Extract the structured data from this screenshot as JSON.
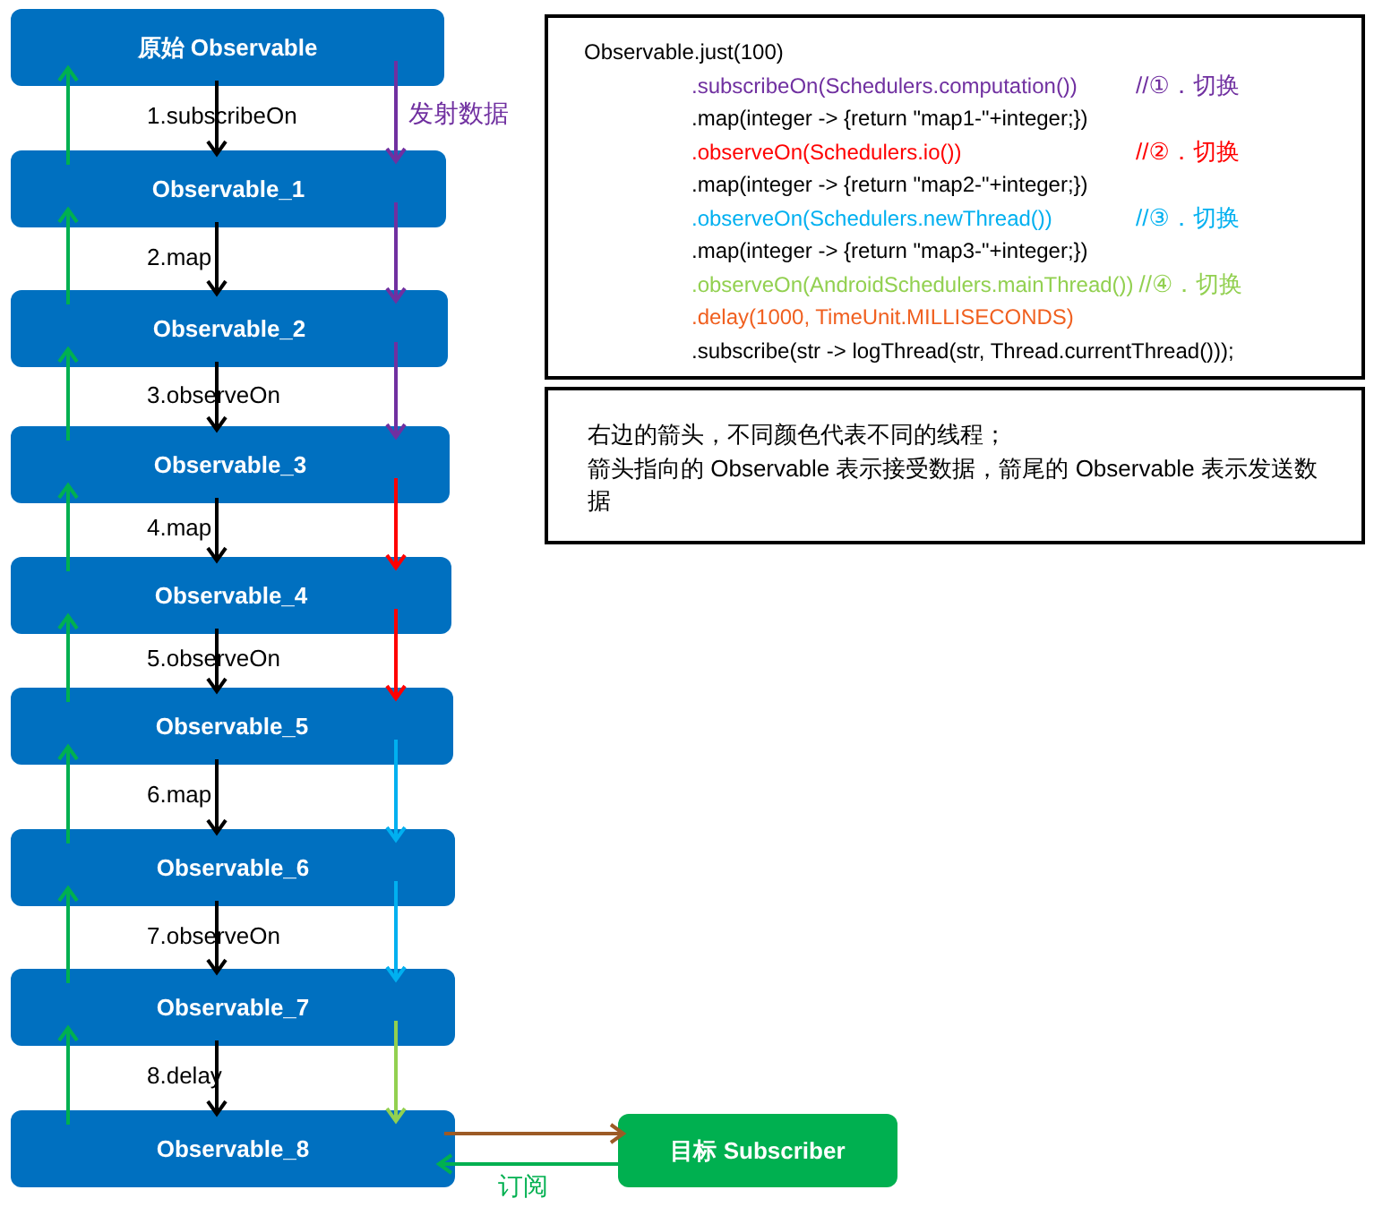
{
  "nodes": [
    {
      "label": "原始 Observable"
    },
    {
      "label": "Observable_1"
    },
    {
      "label": "Observable_2"
    },
    {
      "label": "Observable_3"
    },
    {
      "label": "Observable_4"
    },
    {
      "label": "Observable_5"
    },
    {
      "label": "Observable_6"
    },
    {
      "label": "Observable_7"
    },
    {
      "label": "Observable_8"
    }
  ],
  "steps": [
    {
      "label": "1.subscribeOn",
      "color": "#7030a0"
    },
    {
      "label": "2.map",
      "color": "#7030a0"
    },
    {
      "label": "3.observeOn",
      "color": "#7030a0"
    },
    {
      "label": "4.map",
      "color": "#ff0000"
    },
    {
      "label": "5.observeOn",
      "color": "#ff0000"
    },
    {
      "label": "6.map",
      "color": "#00b0f0"
    },
    {
      "label": "7.observeOn",
      "color": "#00b0f0"
    },
    {
      "label": "8.delay",
      "color": "#92d050"
    }
  ],
  "emit_label": "发射数据",
  "subscriber": {
    "label": "目标 Subscriber"
  },
  "subscribe_label": "订阅",
  "code": {
    "lines": [
      {
        "text": "Observable.just(100)",
        "color": "#000000",
        "indent": false
      },
      {
        "text": ".subscribeOn(Schedulers.computation())",
        "comment": "//①．切换",
        "color": "#7030a0",
        "indent": true
      },
      {
        "text": ".map(integer -> {return \"map1-\"+integer;})",
        "color": "#000000",
        "indent": true
      },
      {
        "text": ".observeOn(Schedulers.io())",
        "comment": "//②．切换",
        "color": "#ff0000",
        "indent": true
      },
      {
        "text": ".map(integer -> {return \"map2-\"+integer;})",
        "color": "#000000",
        "indent": true
      },
      {
        "text": ".observeOn(Schedulers.newThread())",
        "comment": "//③．切换",
        "color": "#00b0f0",
        "indent": true
      },
      {
        "text": ".map(integer -> {return \"map3-\"+integer;})",
        "color": "#000000",
        "indent": true
      },
      {
        "text": ".observeOn(AndroidSchedulers.mainThread())",
        "comment": "//④．切换",
        "color": "#92d050",
        "indent": true
      },
      {
        "text": ".delay(1000, TimeUnit.MILLISECONDS)",
        "color": "#f06020",
        "indent": true
      },
      {
        "text": ".subscribe(str -> logThread(str, Thread.currentThread()));",
        "color": "#000000",
        "indent": true
      }
    ]
  },
  "note": {
    "paragraphs": [
      "右边的箭头，不同颜色代表不同的线程；",
      "箭头指向的 Observable 表示接受数据，箭尾的 Observable 表示发送数据"
    ]
  }
}
